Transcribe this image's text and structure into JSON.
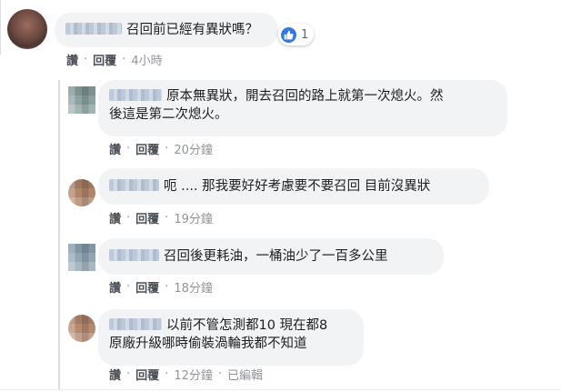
{
  "comments": [
    {
      "text": "召回前已經有異狀嗎？",
      "reaction_count": "1",
      "actions": {
        "like": "讚",
        "reply": "回覆",
        "time": "4小時"
      }
    },
    {
      "text_line1": "原本無異狀，開去召回的路上就第一次熄火。然",
      "text_line2": "後這是第二次熄火。",
      "actions": {
        "like": "讚",
        "reply": "回覆",
        "time": "20分鐘"
      }
    },
    {
      "text": "呃 .... 那我要好好考慮要不要召回 目前沒異狀",
      "actions": {
        "like": "讚",
        "reply": "回覆",
        "time": "19分鐘"
      }
    },
    {
      "text": "召回後更耗油，一桶油少了一百多公里",
      "actions": {
        "like": "讚",
        "reply": "回覆",
        "time": "18分鐘"
      }
    },
    {
      "text_line1": "以前不管怎測都10 現在都8",
      "text_line2": "原廠升級哪時偷裝渦輪我都不知道",
      "actions": {
        "like": "讚",
        "reply": "回覆",
        "time": "12分鐘",
        "edited": "已編輯"
      }
    }
  ],
  "separator": "·",
  "icons": {
    "like": "thumbs-up-icon"
  },
  "colors": {
    "like_blue": "#3578e5",
    "bubble": "#f2f3f5",
    "link": "#385898"
  }
}
